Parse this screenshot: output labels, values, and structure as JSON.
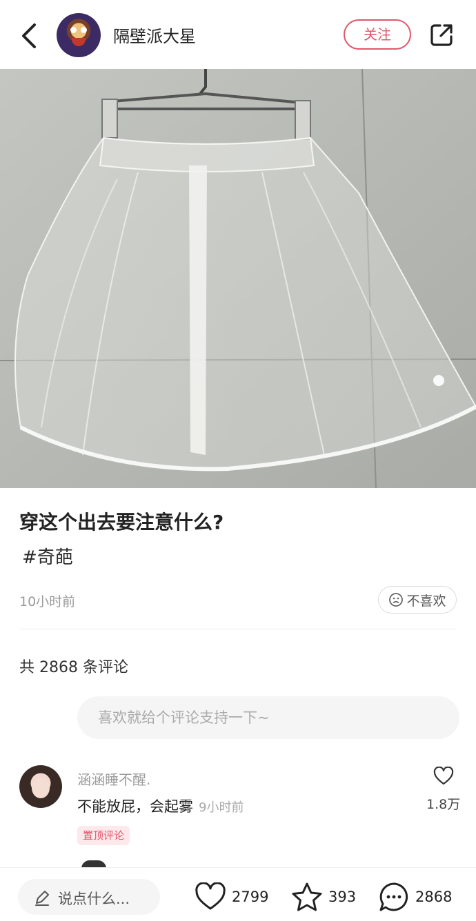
{
  "header": {
    "username": "隔壁派大星",
    "follow_label": "关注"
  },
  "post": {
    "title": "穿这个出去要注意什么?",
    "hashtag": "#奇葩",
    "time_ago": "10小时前",
    "dislike_label": "不喜欢"
  },
  "comments": {
    "total_label": "共 2868 条评论",
    "input_placeholder": "喜欢就给个评论支持一下~",
    "items": [
      {
        "name": "涵涵睡不醒.",
        "text": "不能放屁，会起雾",
        "time_ago": "9小时前",
        "badge": "置顶评论",
        "likes": "1.8万"
      }
    ]
  },
  "bottom_bar": {
    "say_placeholder": "说点什么...",
    "likes": "2799",
    "favorites": "393",
    "comments": "2868"
  },
  "colors": {
    "accent": "#e0566a",
    "muted": "#9a9a9a"
  }
}
